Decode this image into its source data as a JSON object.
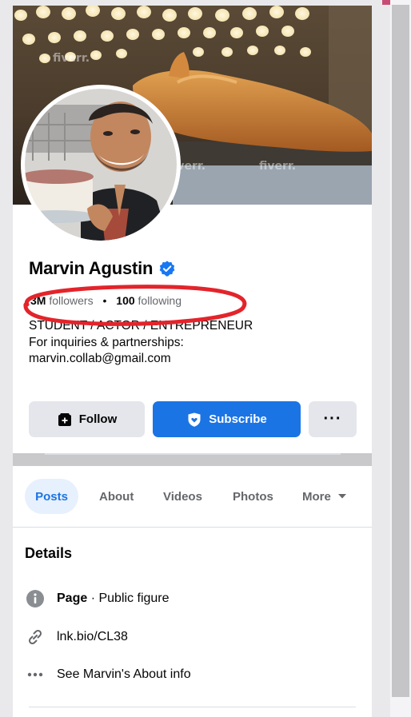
{
  "profile": {
    "name": "Marvin Agustin",
    "followers_count": "3M",
    "followers_label": "followers",
    "following_count": "100",
    "following_label": "following",
    "separator": "•",
    "bio": [
      "STUDENT / ACTOR / ENTREPRENEUR",
      "For inquiries & partnerships:",
      "marvin.collab@gmail.com"
    ]
  },
  "cover": {
    "watermark": "fiverr."
  },
  "actions": {
    "follow_label": "Follow",
    "subscribe_label": "Subscribe",
    "more_label": "···"
  },
  "tabs": [
    "Posts",
    "About",
    "Videos",
    "Photos",
    "More"
  ],
  "details": {
    "title": "Details",
    "page_label": "Page",
    "page_category": " · Public figure",
    "link": "lnk.bio/CL38",
    "about_info": "See Marvin's About info"
  },
  "colors": {
    "brand_blue": "#1b74e4",
    "annotation_red": "#e3242b",
    "verified_blue": "#1877f2"
  },
  "icons": [
    "follow-icon",
    "subscribe-shield-icon",
    "more-dots-icon",
    "chevron-down-icon",
    "info-icon",
    "link-icon",
    "dots-icon",
    "verified-badge-icon"
  ]
}
